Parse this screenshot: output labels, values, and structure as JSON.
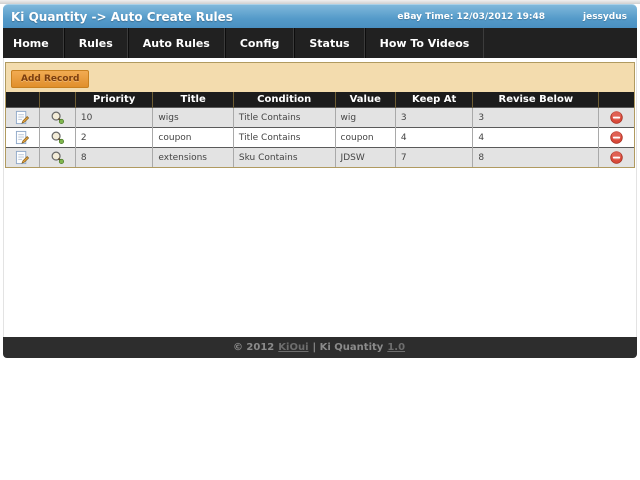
{
  "header": {
    "title": "Ki Quantity -> Auto Create Rules",
    "ebay_time": "eBay Time: 12/03/2012 19:48",
    "username": "jessydus"
  },
  "nav": {
    "items": {
      "home": "Home",
      "rules": "Rules",
      "auto_rules": "Auto Rules",
      "config": "Config",
      "status": "Status",
      "how_to_videos": "How To Videos"
    }
  },
  "toolbar": {
    "add_record_label": "Add Record"
  },
  "table": {
    "columns": {
      "priority": "Priority",
      "title": "Title",
      "condition": "Condition",
      "value": "Value",
      "keep_at": "Keep At",
      "revise_below": "Revise Below"
    },
    "rows": [
      {
        "priority": "10",
        "title": "wigs",
        "condition": "Title Contains",
        "value": "wig",
        "keep_at": "3",
        "revise_below": "3"
      },
      {
        "priority": "2",
        "title": "coupon",
        "condition": "Title Contains",
        "value": "coupon",
        "keep_at": "4",
        "revise_below": "4"
      },
      {
        "priority": "8",
        "title": "extensions",
        "condition": "Sku Contains",
        "value": "JDSW",
        "keep_at": "7",
        "revise_below": "8"
      }
    ],
    "icon_names": {
      "edit": "edit-icon",
      "zoom": "zoom-icon",
      "delete": "delete-icon"
    }
  },
  "footer": {
    "copyright": "© 2012",
    "site_link": "KiOui",
    "middle": "| Ki Quantity",
    "version_link": "1.0"
  },
  "colors": {
    "header_blue": "#549ac9",
    "nav_dark": "#212121",
    "panel_tan": "#f3dcae",
    "button_orange": "#e0982f",
    "button_text": "#7c3e0f",
    "row_stripe": "#e3e3e3",
    "table_header": "#1c1c1c",
    "footer_dark": "#2d2d2d",
    "delete_red": "#cf3b2a"
  }
}
